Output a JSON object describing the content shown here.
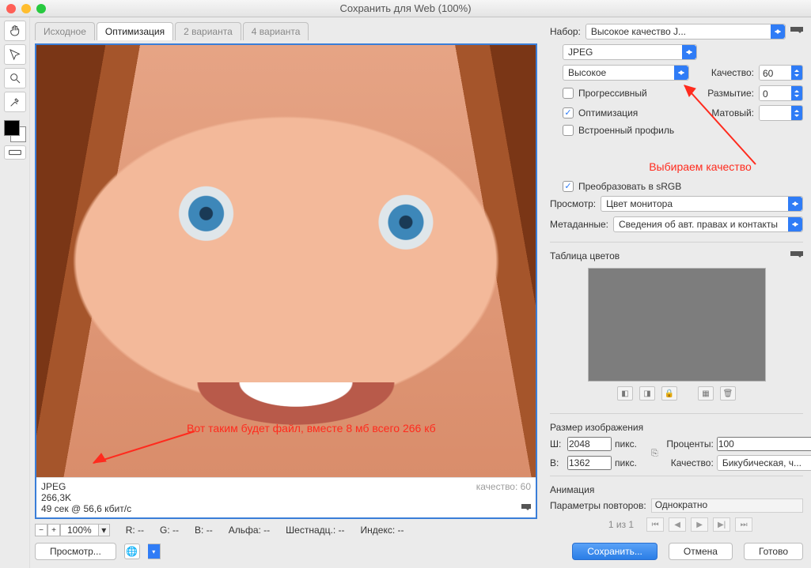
{
  "window": {
    "title": "Сохранить для Web (100%)"
  },
  "tabs": [
    "Исходное",
    "Оптимизация",
    "2 варианта",
    "4 варианта"
  ],
  "active_tab_index": 1,
  "info": {
    "format": "JPEG",
    "size": "266,3K",
    "time": "49 сек @ 56,6 кбит/с",
    "quality_label": "качество: 60"
  },
  "annotations": {
    "file_size": "Вот таким будет файл, вместе 8 мб всего 266 кб",
    "quality_choice": "Выбираем качество"
  },
  "status": {
    "zoom": "100%",
    "R": "R: --",
    "G": "G: --",
    "B": "B: --",
    "Alpha": "Альфа: --",
    "Hex": "Шестнадц.: --",
    "Index": "Индекс: --"
  },
  "preset": {
    "label": "Набор:",
    "value": "Высокое качество J...",
    "format": "JPEG",
    "quality_preset": "Высокое",
    "quality_label": "Качество:",
    "quality_value": "60",
    "progressive": "Прогрессивный",
    "optimized": "Оптимизация",
    "embedded": "Встроенный профиль",
    "blur_label": "Размытие:",
    "blur_value": "0",
    "matte_label": "Матовый:"
  },
  "convert": {
    "srgb": "Преобразовать в sRGB"
  },
  "preview": {
    "label": "Просмотр:",
    "value": "Цвет монитора"
  },
  "metadata": {
    "label": "Метаданные:",
    "value": "Сведения об авт. правах и контакты"
  },
  "color_table": {
    "title": "Таблица цветов"
  },
  "image_size": {
    "title": "Размер изображения",
    "w_label": "Ш:",
    "w": "2048",
    "h_label": "В:",
    "h": "1362",
    "unit": "пикс.",
    "percent_label": "Проценты:",
    "percent": "100",
    "quality_label": "Качество:",
    "resample": "Бикубическая, ч..."
  },
  "animation": {
    "title": "Анимация",
    "loop_label": "Параметры повторов:",
    "loop_value": "Однократно",
    "counter": "1 из 1"
  },
  "buttons": {
    "preview": "Просмотр...",
    "save": "Сохранить...",
    "cancel": "Отмена",
    "done": "Готово"
  }
}
